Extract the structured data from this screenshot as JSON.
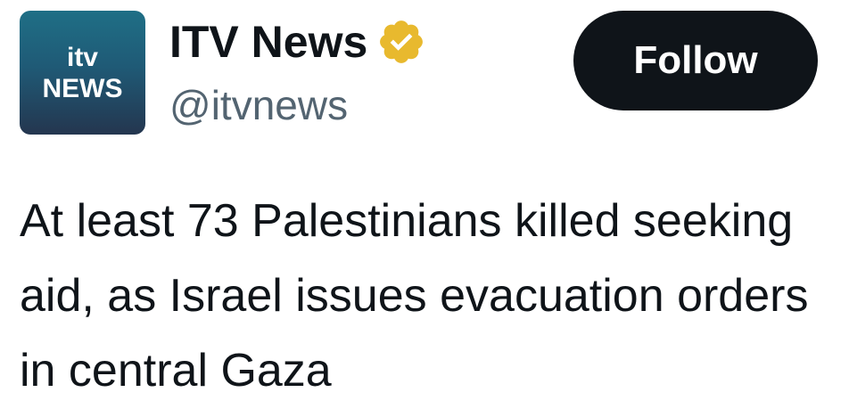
{
  "account": {
    "avatar_line1": "itv",
    "avatar_line2": "NEWS",
    "display_name": "ITV News",
    "handle": "@itvnews",
    "verified_icon": "verified-badge-icon",
    "verified_color": "#e8b92e"
  },
  "actions": {
    "follow_label": "Follow"
  },
  "tweet": {
    "text": "At least 73 Palestinians killed seeking aid, as Israel issues evacuation orders in central Gaza"
  }
}
